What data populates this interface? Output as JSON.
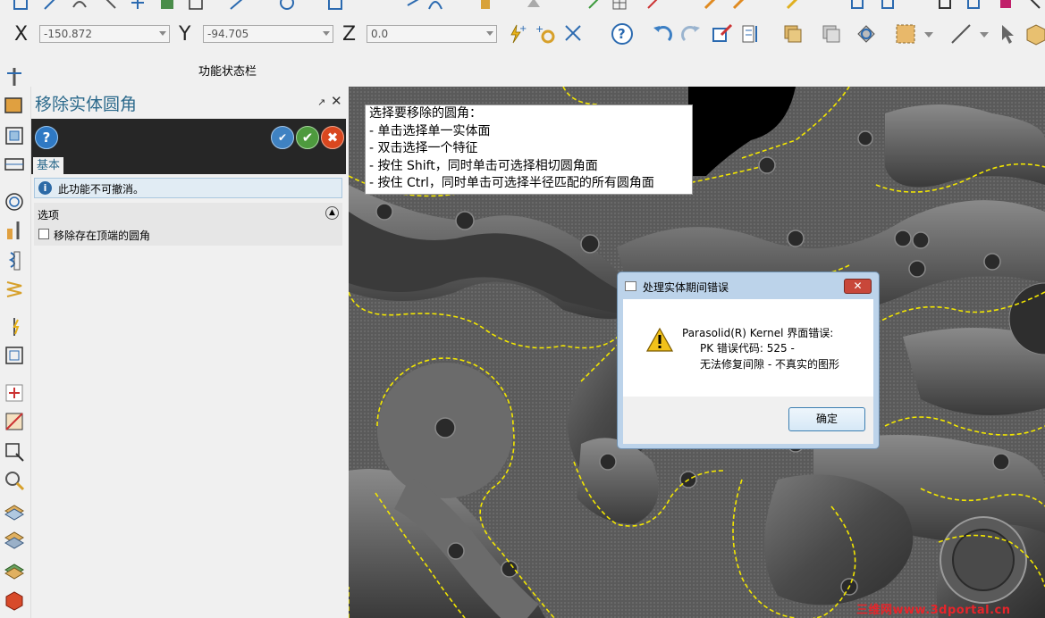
{
  "coordinates": {
    "x_label": "X",
    "x_value": "-150.872",
    "y_label": "Y",
    "y_value": "-94.705",
    "z_label": "Z",
    "z_value": "0.0"
  },
  "status_bar_title": "功能状态栏",
  "panel": {
    "title": "移除实体圆角",
    "pin_glyph": "↗",
    "close_glyph": "✕",
    "help_glyph": "?",
    "apply_glyph": "✔",
    "ok_glyph": "✔",
    "cancel_glyph": "✖",
    "tab_basic": "基本",
    "info_text": "此功能不可撤消。",
    "options_section": "选项",
    "option_remove_top_fillet": "移除存在顶端的圆角"
  },
  "tooltip_lines": [
    "选择要移除的圆角：",
    "- 单击选择单一实体面",
    "- 双击选择一个特征",
    "- 按住 Shift，同时单击可选择相切圆角面",
    "- 按住 Ctrl，同时单击可选择半径匹配的所有圆角面"
  ],
  "dialog": {
    "title": "处理实体期间错误",
    "line1": "Parasolid(R) Kernel 界面错误:",
    "line2": "PK 错误代码: 525 -",
    "line3": "无法修复间隙 - 不真实的图形",
    "ok_button": "确定"
  },
  "watermark": "三维网www.3dportal.cn",
  "colors": {
    "panel_title": "#2c6a8c",
    "dark_band": "#262626",
    "help_button": "#2f79c4",
    "apply_button": "#3f82c2",
    "ok_button": "#4e9a3e",
    "cancel_button": "#d9471f",
    "selection_outline": "#f2e600",
    "watermark": "#e8242a"
  }
}
